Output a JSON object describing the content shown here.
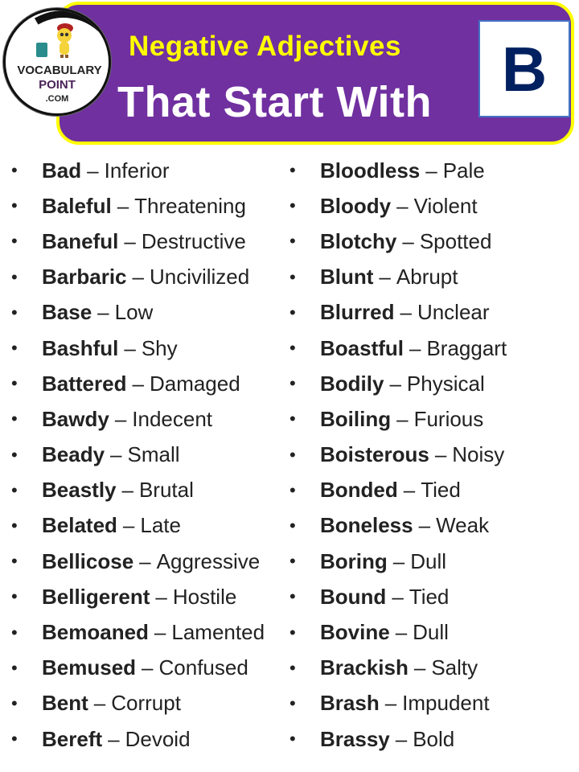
{
  "header": {
    "title_line1": "Negative Adjectives",
    "title_line2": "That Start With",
    "letter": "B",
    "colors": {
      "banner": "#7030a0",
      "border": "#ffff00",
      "title1": "#ffff00",
      "title2": "#ffffff",
      "letter": "#002060"
    }
  },
  "logo": {
    "line1": "VOCABULARY",
    "line2": "POINT",
    "line3": ".COM",
    "icon": "mascot-icon"
  },
  "separator": "–",
  "bullet": "•",
  "left_column": [
    {
      "word": "Bad",
      "meaning": "Inferior"
    },
    {
      "word": "Baleful",
      "meaning": "Threatening"
    },
    {
      "word": "Baneful",
      "meaning": "Destructive"
    },
    {
      "word": "Barbaric",
      "meaning": "Uncivilized"
    },
    {
      "word": "Base",
      "meaning": "Low"
    },
    {
      "word": "Bashful",
      "meaning": "Shy"
    },
    {
      "word": "Battered",
      "meaning": "Damaged"
    },
    {
      "word": "Bawdy",
      "meaning": "Indecent"
    },
    {
      "word": "Beady",
      "meaning": "Small"
    },
    {
      "word": "Beastly",
      "meaning": "Brutal"
    },
    {
      "word": "Belated",
      "meaning": "Late"
    },
    {
      "word": "Bellicose",
      "meaning": "Aggressive"
    },
    {
      "word": "Belligerent",
      "meaning": "Hostile"
    },
    {
      "word": "Bemoaned",
      "meaning": "Lamented"
    },
    {
      "word": "Bemused",
      "meaning": "Confused"
    },
    {
      "word": "Bent",
      "meaning": "Corrupt"
    },
    {
      "word": "Bereft",
      "meaning": "Devoid"
    }
  ],
  "right_column": [
    {
      "word": "Bloodless",
      "meaning": "Pale"
    },
    {
      "word": "Bloody",
      "meaning": "Violent"
    },
    {
      "word": "Blotchy",
      "meaning": "Spotted"
    },
    {
      "word": "Blunt",
      "meaning": "Abrupt"
    },
    {
      "word": "Blurred",
      "meaning": "Unclear"
    },
    {
      "word": "Boastful",
      "meaning": "Braggart"
    },
    {
      "word": "Bodily",
      "meaning": "Physical"
    },
    {
      "word": "Boiling",
      "meaning": "Furious"
    },
    {
      "word": "Boisterous",
      "meaning": "Noisy"
    },
    {
      "word": "Bonded",
      "meaning": "Tied"
    },
    {
      "word": "Boneless",
      "meaning": "Weak"
    },
    {
      "word": "Boring",
      "meaning": "Dull"
    },
    {
      "word": "Bound",
      "meaning": "Tied"
    },
    {
      "word": "Bovine",
      "meaning": "Dull"
    },
    {
      "word": "Brackish",
      "meaning": "Salty"
    },
    {
      "word": "Brash",
      "meaning": "Impudent"
    },
    {
      "word": "Brassy",
      "meaning": "Bold"
    }
  ]
}
